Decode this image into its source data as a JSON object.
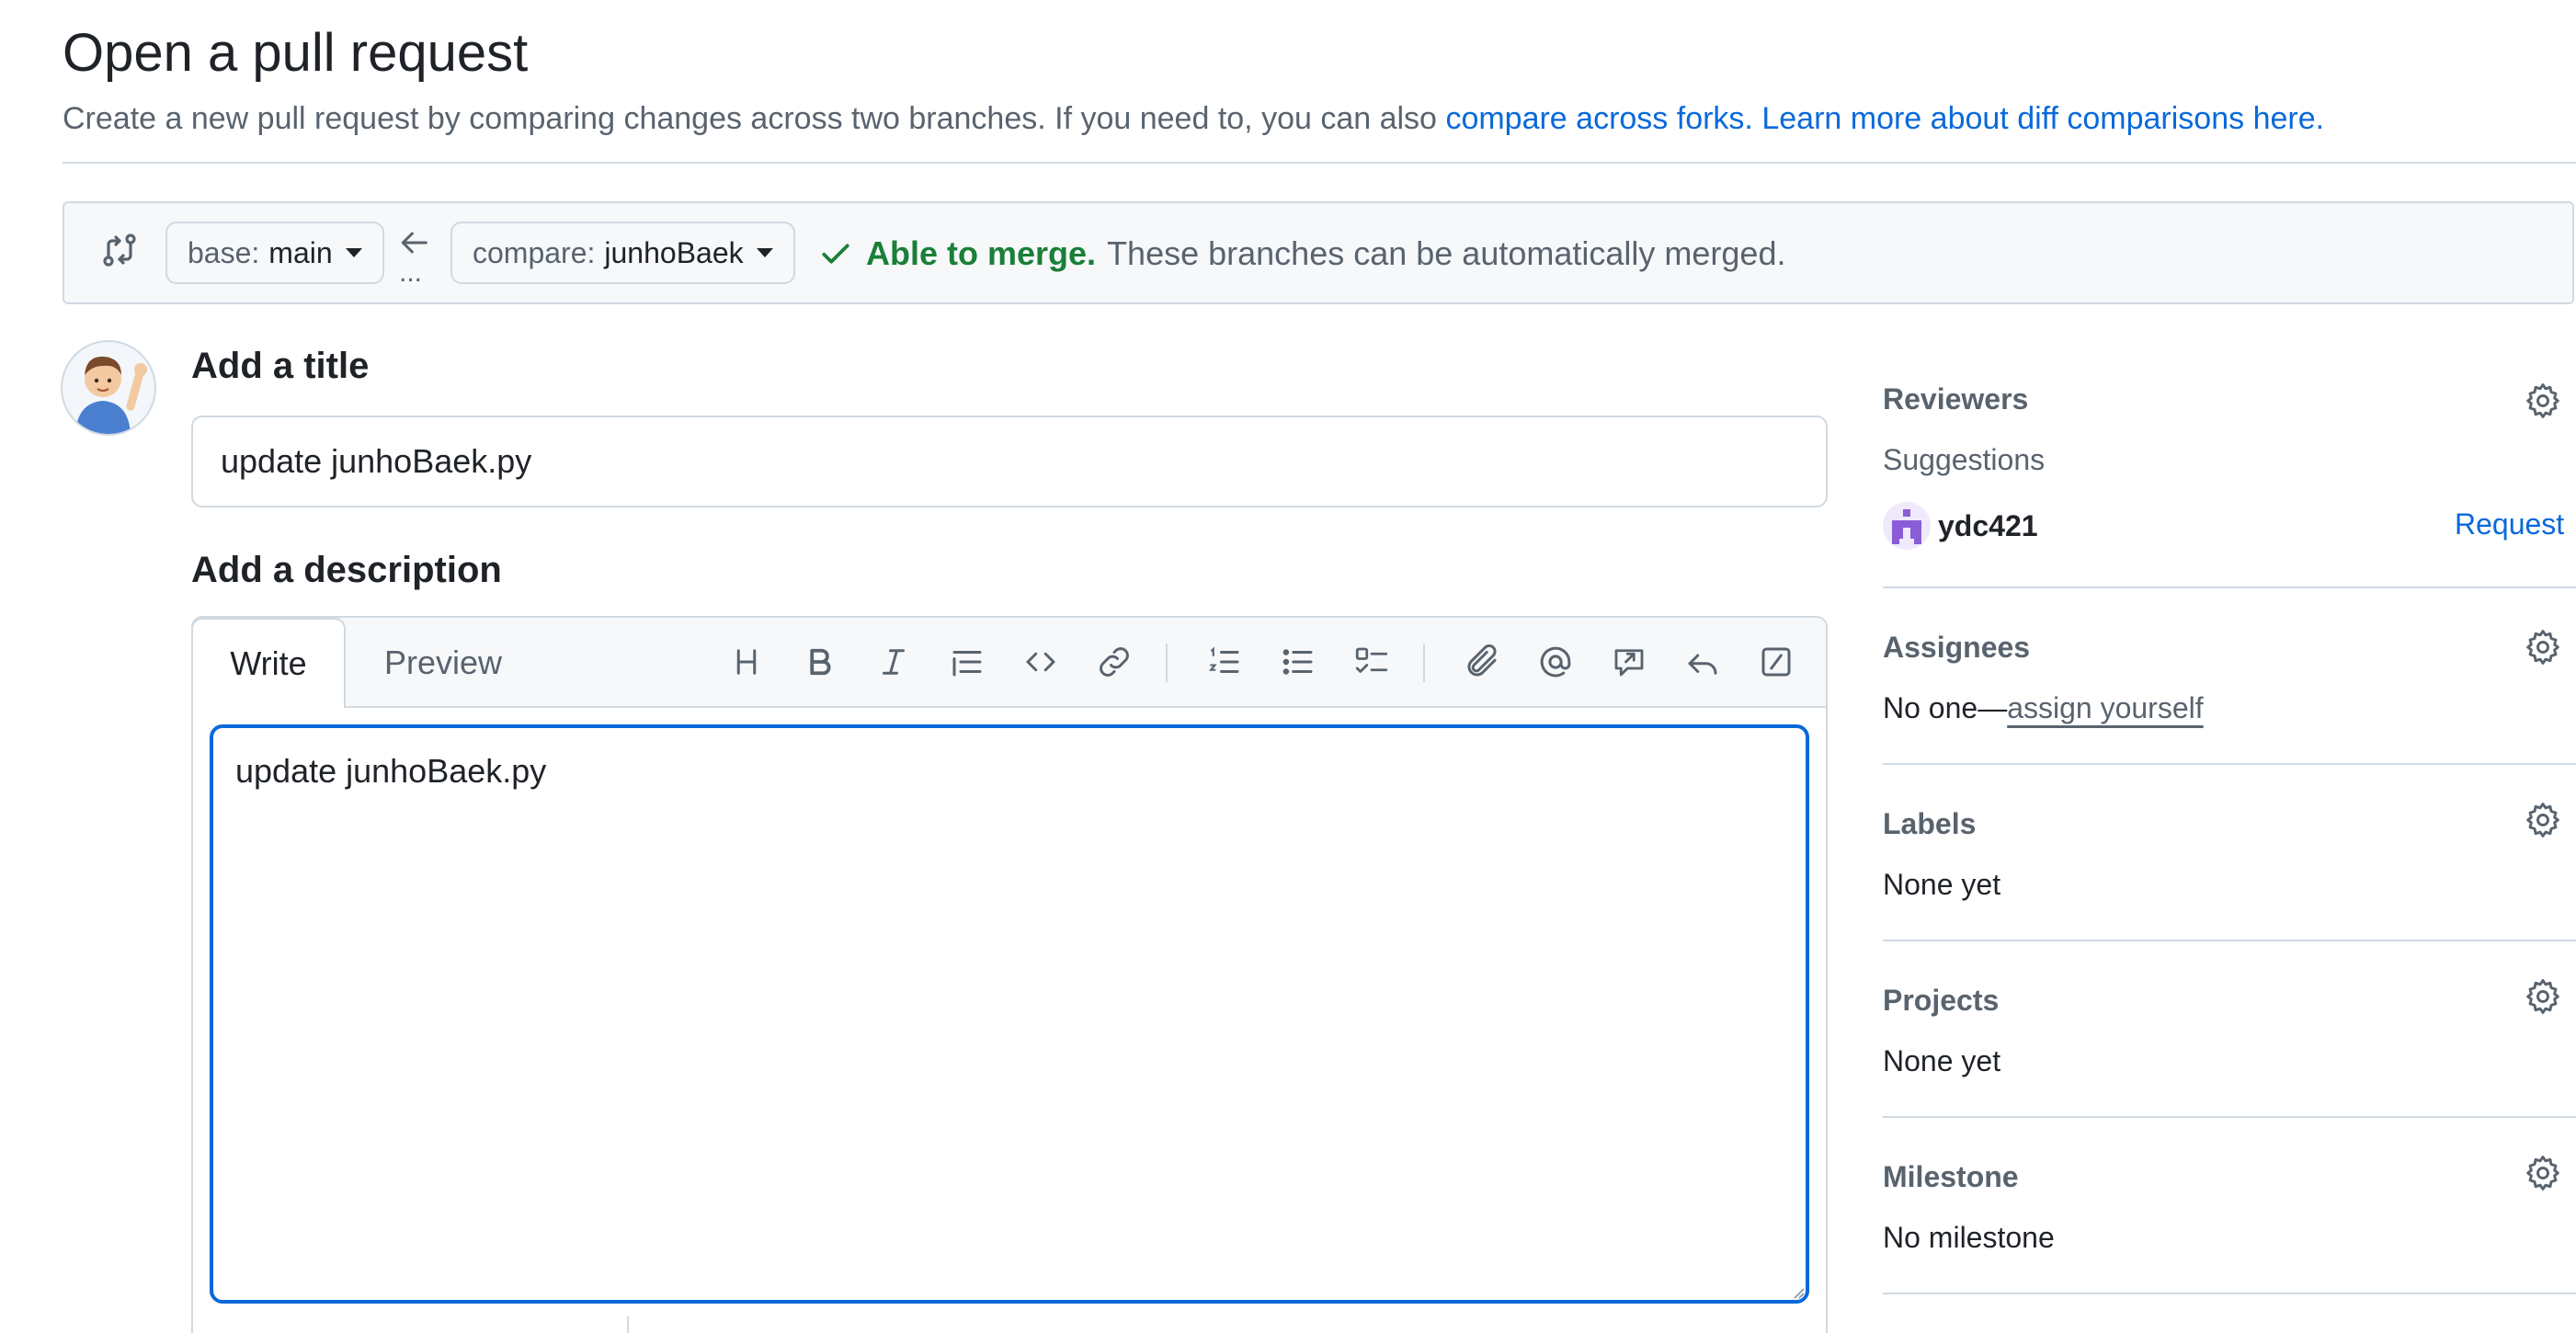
{
  "header": {
    "title": "Open a pull request",
    "subtitle_text": "Create a new pull request by comparing changes across two branches. If you need to, you can also",
    "compare_forks_link": "compare across forks.",
    "learn_more_link": "Learn more about diff comparisons here."
  },
  "range": {
    "base_label": "base:",
    "base_value": "main",
    "compare_label": "compare:",
    "compare_value": "junhoBaek",
    "ellipsis": "...",
    "merge_ok": "Able to merge.",
    "merge_msg": "These branches can be automatically merged."
  },
  "form": {
    "title_heading": "Add a title",
    "title_value": "update junhoBaek.py",
    "description_heading": "Add a description",
    "tabs": [
      {
        "label": "Write",
        "active": true
      },
      {
        "label": "Preview",
        "active": false
      }
    ],
    "description_value": "update junhoBaek.py",
    "toolbar_icons": [
      "heading-icon",
      "bold-icon",
      "italic-icon",
      "quote-icon",
      "code-icon",
      "link-icon",
      "numbered-list-icon",
      "unordered-list-icon",
      "task-list-icon",
      "attach-icon",
      "mention-icon",
      "reference-icon",
      "reply-icon",
      "slash-command-icon"
    ]
  },
  "sidebar": {
    "reviewers": {
      "heading": "Reviewers",
      "suggestions_label": "Suggestions",
      "suggested_user": "ydc421",
      "request_label": "Request"
    },
    "assignees": {
      "heading": "Assignees",
      "text": "No one—",
      "assign_link": "assign yourself"
    },
    "labels": {
      "heading": "Labels",
      "text": "None yet"
    },
    "projects": {
      "heading": "Projects",
      "text": "None yet"
    },
    "milestone": {
      "heading": "Milestone",
      "text": "No milestone"
    }
  },
  "colors": {
    "accent_blue": "#0969da",
    "success_green": "#1a7f37",
    "border": "#d1d9e0",
    "muted_text": "#59636e",
    "header_bg": "#f6f8fa"
  }
}
